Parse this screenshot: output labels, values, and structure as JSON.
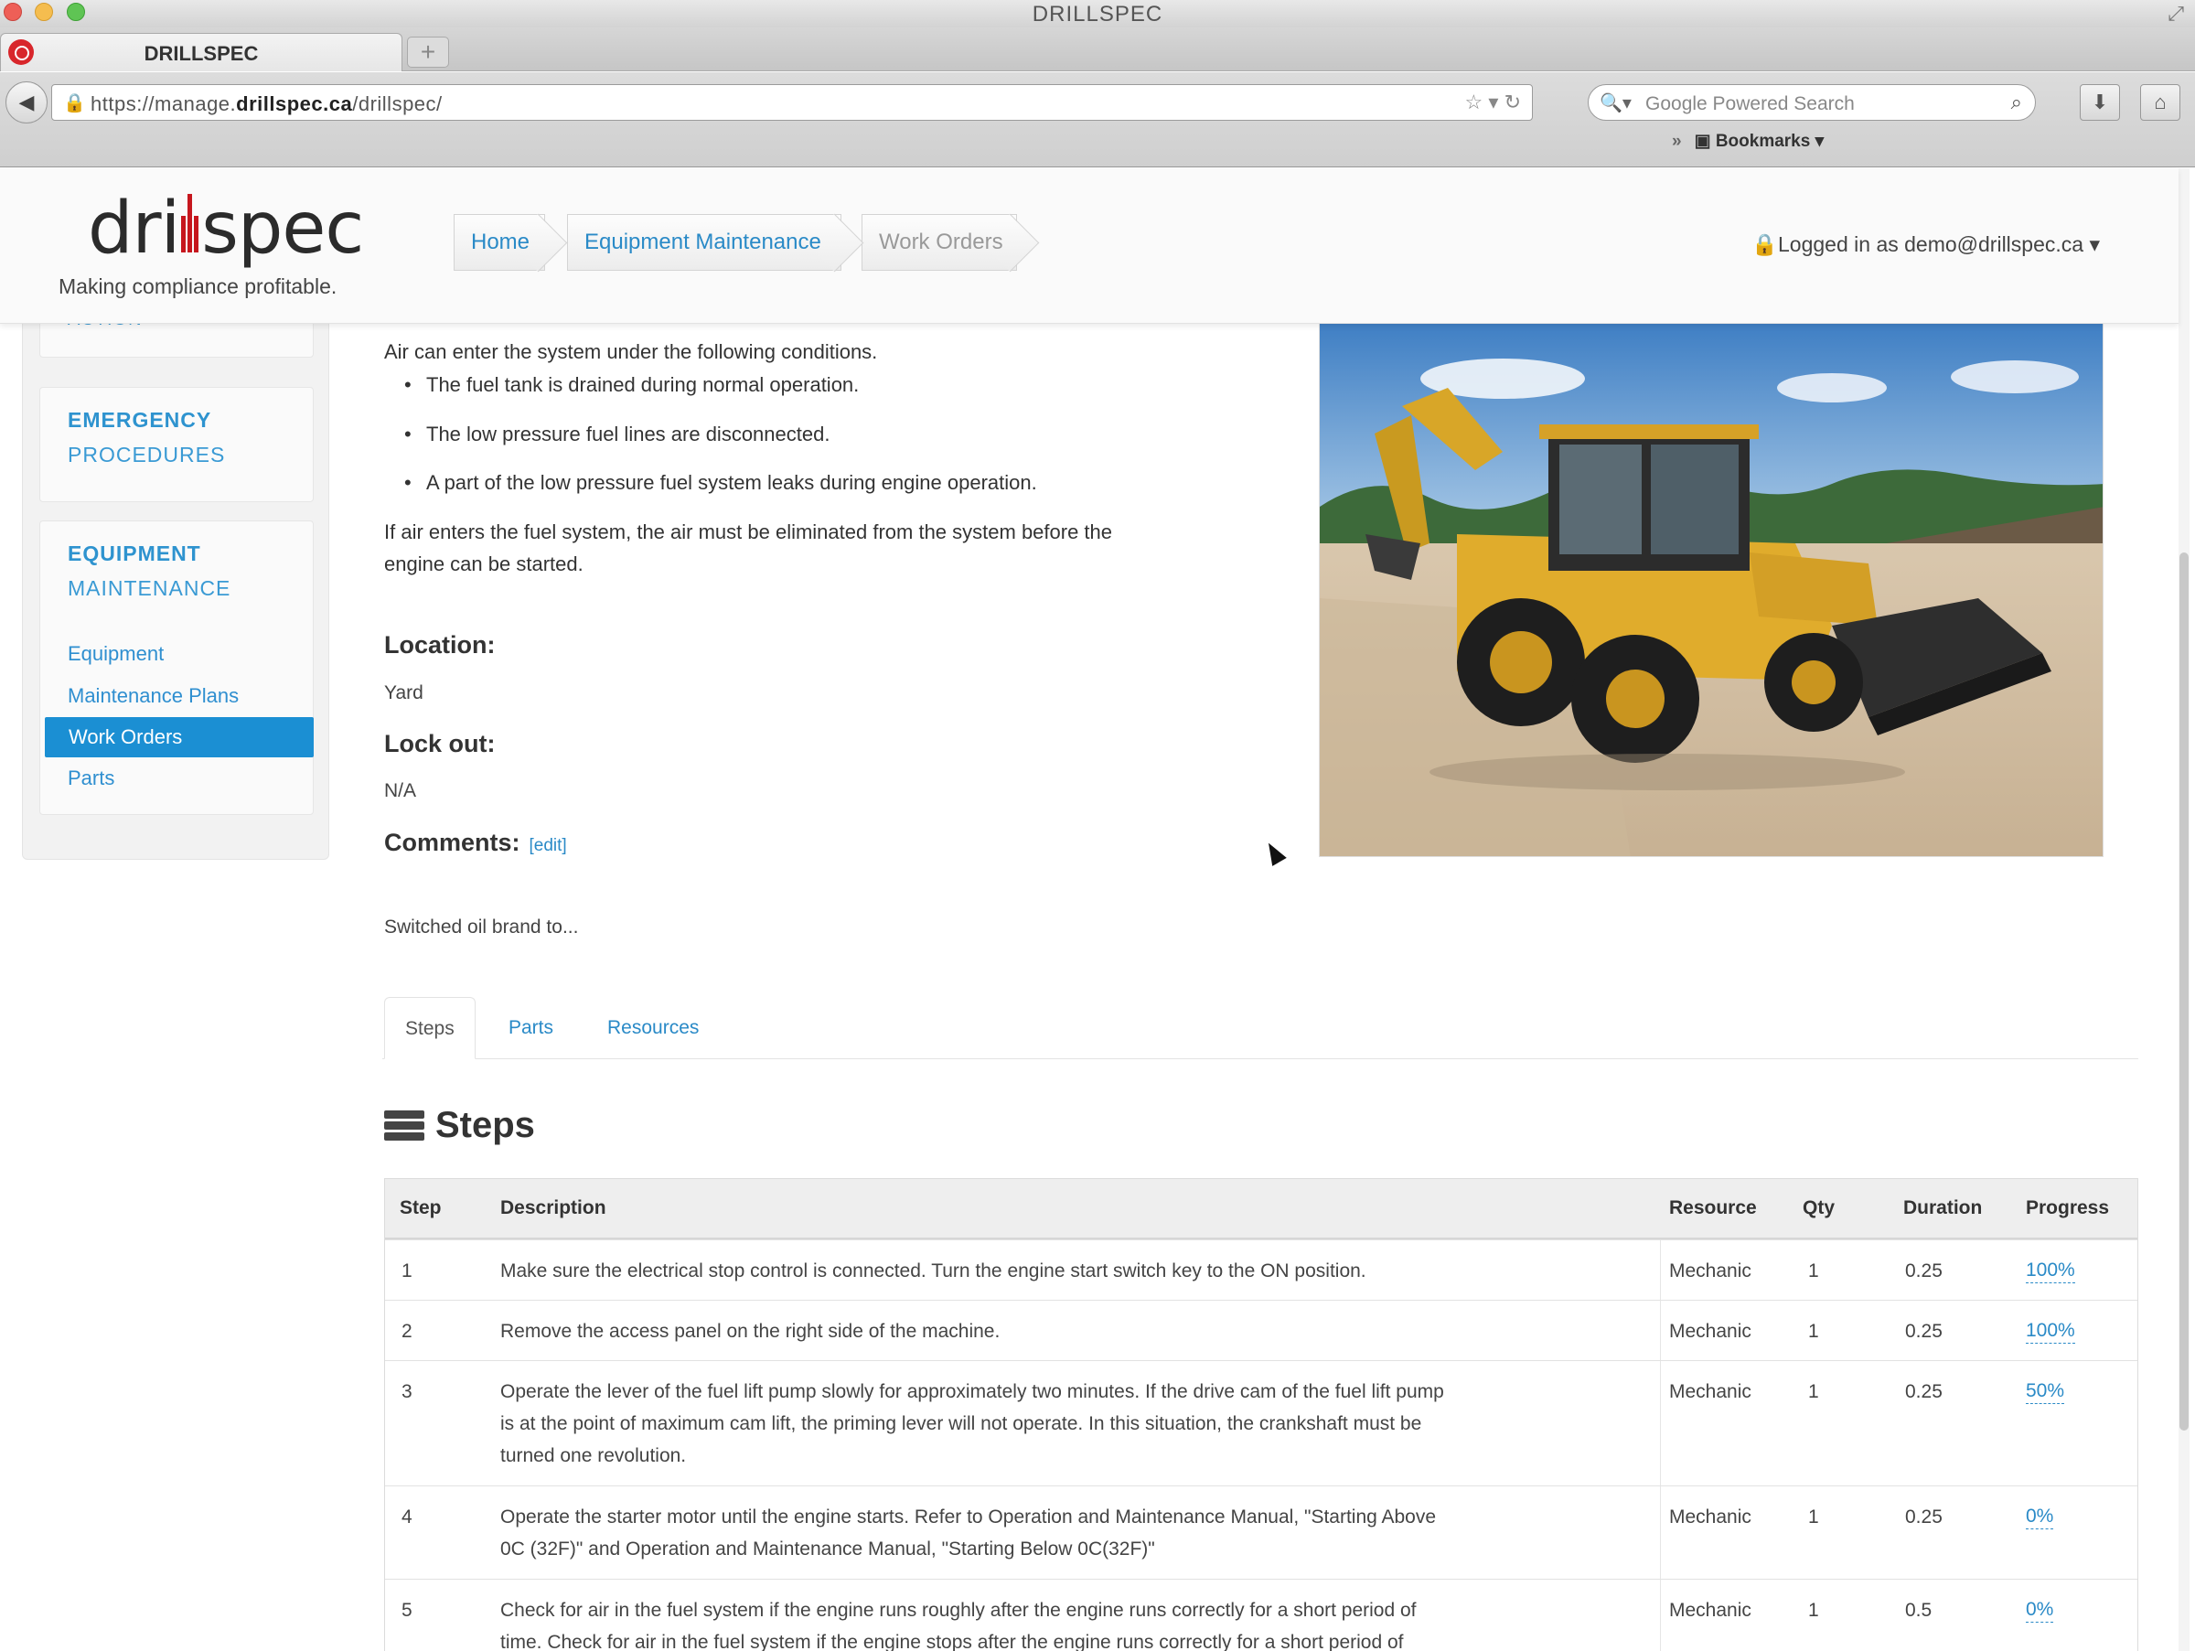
{
  "window": {
    "title": "DRILLSPEC"
  },
  "browser": {
    "tab_title": "DRILLSPEC",
    "new_tab": "+",
    "url_parts": [
      "https://manage.",
      "drillspec.ca",
      "/drillspec/"
    ],
    "search_placeholder": "Google Powered Search",
    "bookmarks_label": "Bookmarks",
    "bookmarks_chevron": "»"
  },
  "header": {
    "logo_left": "dri",
    "logo_right": "spec",
    "tagline": "Making compliance profitable.",
    "breadcrumbs": [
      "Home",
      "Equipment Maintenance",
      "Work Orders"
    ],
    "login": "Logged in as demo@drillspec.ca"
  },
  "sidebar": {
    "partial": "ACTION",
    "emergency_head": "EMERGENCY",
    "emergency_sub": "PROCEDURES",
    "equipment_head": "EQUIPMENT",
    "equipment_sub": "MAINTENANCE",
    "links": [
      "Equipment",
      "Maintenance Plans",
      "Work Orders",
      "Parts"
    ],
    "active_index": 2
  },
  "content": {
    "intro": "Air can enter the system under the following conditions.",
    "bullets": [
      "The fuel tank is drained during normal operation.",
      "The low pressure fuel lines are disconnected.",
      "A part of the low pressure fuel system leaks during engine operation."
    ],
    "paragraph_1": "If air enters the fuel system, the air must be eliminated from the system before the",
    "paragraph_2": "engine can be started.",
    "location_label": "Location:",
    "location_value": "Yard",
    "lockout_label": "Lock out:",
    "lockout_value": "N/A",
    "comments_label": "Comments:",
    "comments_edit": "[edit]",
    "comment_text": "Switched oil brand to..."
  },
  "tabs": [
    "Steps",
    "Parts",
    "Resources"
  ],
  "steps": {
    "title": "Steps",
    "columns": [
      "Step",
      "Description",
      "Resource",
      "Qty",
      "Duration",
      "Progress"
    ],
    "rows": [
      {
        "step": "1",
        "desc": [
          "Make sure the electrical stop control is connected. Turn the engine start switch key to the ON position."
        ],
        "resource": "Mechanic",
        "qty": "1",
        "duration": "0.25",
        "progress": "100%"
      },
      {
        "step": "2",
        "desc": [
          "Remove the access panel on the right side of the machine."
        ],
        "resource": "Mechanic",
        "qty": "1",
        "duration": "0.25",
        "progress": "100%"
      },
      {
        "step": "3",
        "desc": [
          "Operate the lever of the fuel lift pump slowly for approximately two minutes. If the drive cam of the fuel lift pump",
          "is at the point of maximum cam lift, the priming lever will not operate. In this situation, the crankshaft must be",
          "turned one revolution."
        ],
        "resource": "Mechanic",
        "qty": "1",
        "duration": "0.25",
        "progress": "50%"
      },
      {
        "step": "4",
        "desc": [
          "Operate the starter motor until the engine starts. Refer to Operation and Maintenance Manual, \"Starting Above",
          "0C (32F)\" and Operation and Maintenance Manual, \"Starting Below 0C(32F)\""
        ],
        "resource": "Mechanic",
        "qty": "1",
        "duration": "0.25",
        "progress": "0%"
      },
      {
        "step": "5",
        "desc": [
          "Check for air in the fuel system if the engine runs roughly after the engine runs correctly for a short period of",
          "time. Check for air in the fuel system if the engine stops after the engine runs correctly for a short period of"
        ],
        "resource": "Mechanic",
        "qty": "1",
        "duration": "0.5",
        "progress": "0%"
      }
    ]
  },
  "colors": {
    "accent": "#2a8ac7",
    "active": "#1b8fd3",
    "brand_red": "#c6161d"
  }
}
